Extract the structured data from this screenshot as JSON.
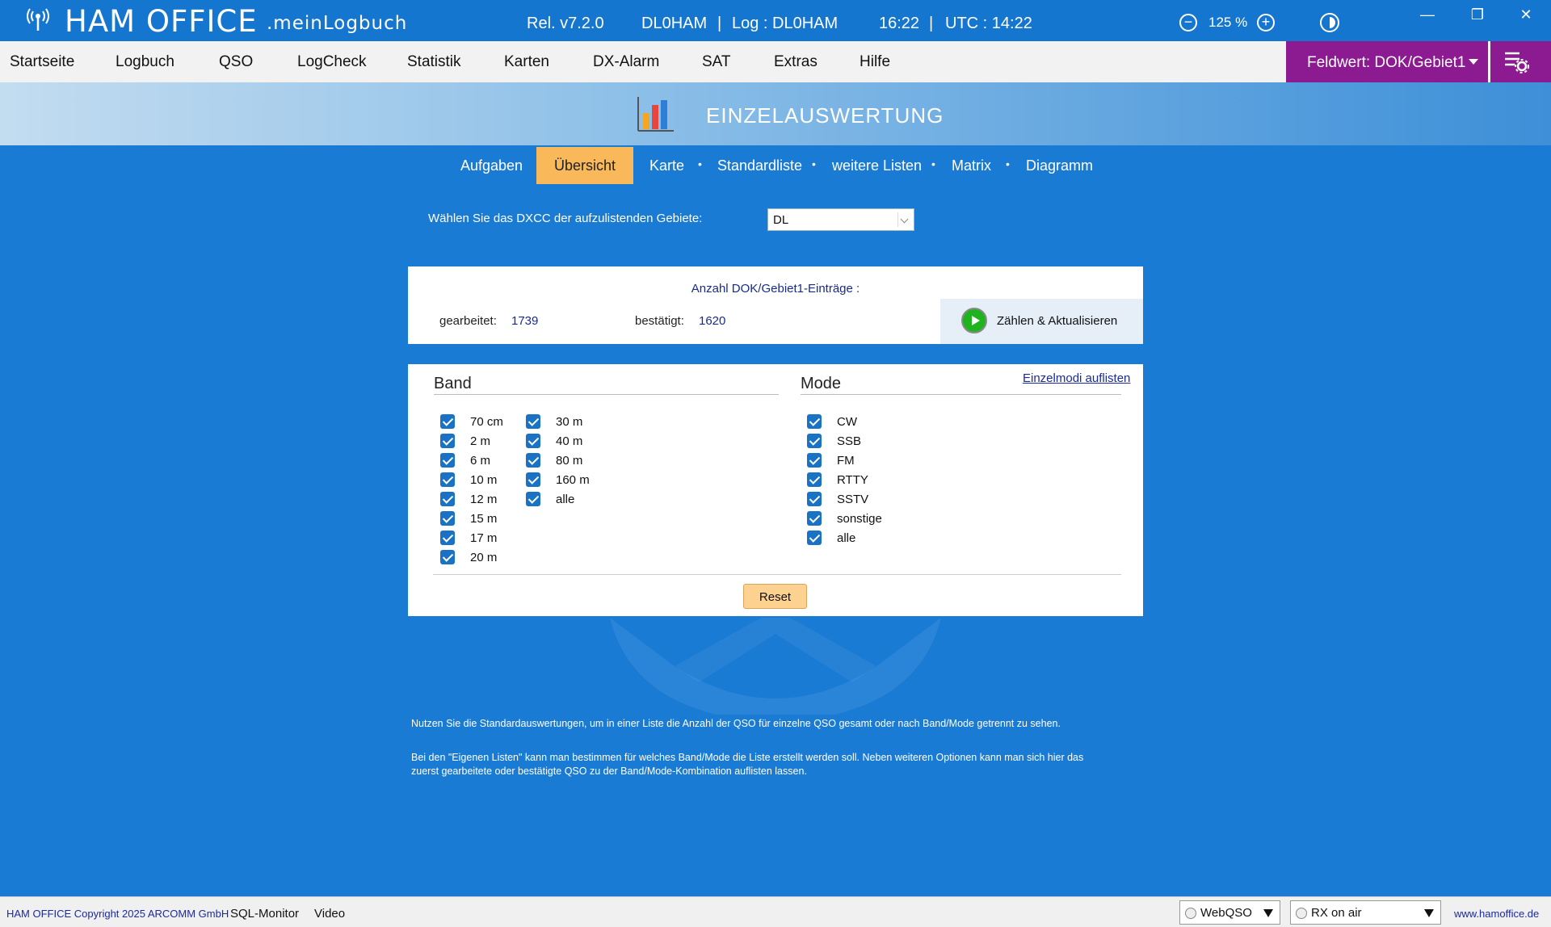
{
  "titlebar": {
    "app_name": "HAM OFFICE",
    "app_sub": ".meinLogbuch",
    "release": "Rel. v7.2.0",
    "callsign": "DL0HAM",
    "sep1": "|",
    "log": "Log : DL0HAM",
    "time": "16:22",
    "sep2": "|",
    "utc": "UTC : 14:22",
    "zoom_out": "−",
    "zoom": "125 %",
    "zoom_in": "+",
    "minimize": "—",
    "restore": "❐",
    "close": "✕"
  },
  "menu": {
    "items": [
      "Startseite",
      "Logbuch",
      "QSO",
      "LogCheck",
      "Statistik",
      "Karten",
      "DX-Alarm",
      "SAT",
      "Extras",
      "Hilfe"
    ],
    "feldwert": "Feldwert:  DOK/Gebiet1"
  },
  "header": {
    "title": "EINZELAUSWERTUNG"
  },
  "tabs": {
    "items": [
      "Aufgaben",
      "Übersicht",
      "Karte",
      "Standardliste",
      "weitere Listen",
      "Matrix",
      "Diagramm"
    ],
    "active": "Übersicht",
    "dot": "•"
  },
  "dxcc": {
    "label": "Wählen Sie das DXCC der aufzulistenden Gebiete:",
    "value": "DL"
  },
  "counts": {
    "title": "Anzahl DOK/Gebiet1-Einträge :",
    "worked_label": "gearbeitet:",
    "worked_value": "1739",
    "confirmed_label": "bestätigt:",
    "confirmed_value": "1620",
    "button": "Zählen & Aktualisieren"
  },
  "band": {
    "title": "Band",
    "col1": [
      "70 cm",
      "2 m",
      "6 m",
      "10 m",
      "12 m",
      "15 m",
      "17 m",
      "20 m"
    ],
    "col2": [
      "30 m",
      "40 m",
      "80 m",
      "160 m",
      "alle"
    ]
  },
  "mode": {
    "title": "Mode",
    "link": "Einzelmodi auflisten",
    "items": [
      "CW",
      "SSB",
      "FM",
      "RTTY",
      "SSTV",
      "sonstige",
      "alle"
    ]
  },
  "reset": "Reset",
  "info": {
    "p1": "Nutzen Sie die Standardauswertungen, um in einer Liste die Anzahl der QSO für einzelne QSO gesamt  oder nach Band/Mode getrennt zu sehen.",
    "p2a": "Bei den \"Eigenen Listen\" kann man bestimmen für welches Band/Mode die Liste erstellt werden soll. Neben weiteren Optionen  kann man sich hier das",
    "p2b": "zuerst gearbeitete oder bestätigte QSO zu der Band/Mode-Kombination auflisten lassen."
  },
  "statusbar": {
    "copyright": "HAM OFFICE Copyright 2025 ARCOMM GmbH",
    "sql": "SQL-Monitor",
    "video": "Video",
    "webqso": "WebQSO",
    "rx": "RX on air",
    "url": "www.hamoffice.de"
  },
  "colors": {
    "titlebar": "#1476cf",
    "accent_purple": "#8c1a91",
    "tab_active": "#f9b95b",
    "checkbox": "#1a72c4"
  }
}
